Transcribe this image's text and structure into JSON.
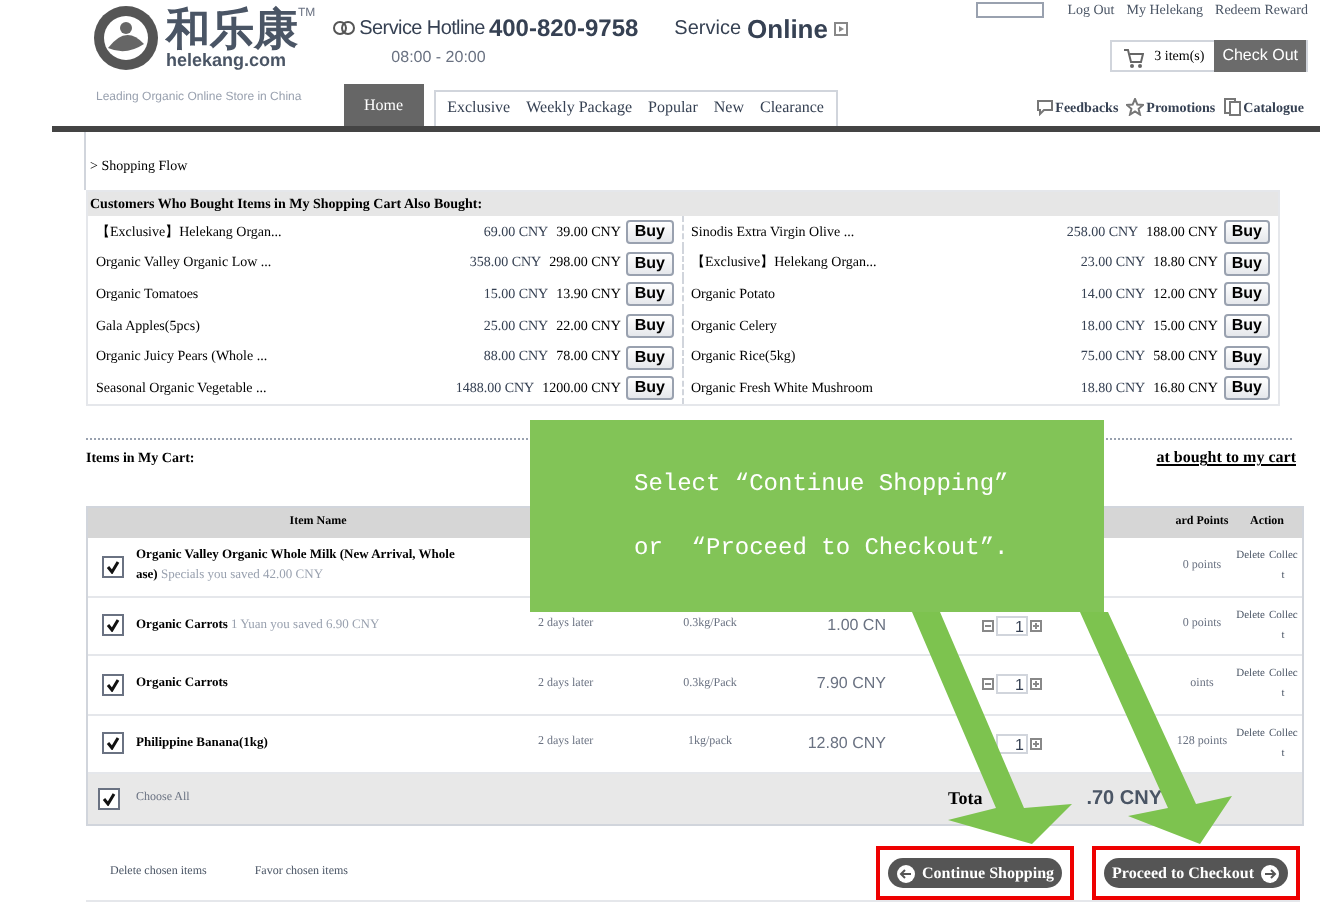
{
  "header": {
    "logo_cn": "和乐康",
    "logo_tm": "TM",
    "logo_domain": "helekang.com",
    "tagline": "Leading Organic Online Store in China",
    "hotline_label": "Service Hotline",
    "hotline_number": "400-820-9758",
    "hours": "08:00 - 20:00",
    "service_label": "Service",
    "service_online": "Online",
    "top_links": [
      "Log Out",
      "My Helekang",
      "Redeem Reward"
    ],
    "cart_count": "3 item(s)",
    "checkout": "Check Out"
  },
  "nav": {
    "tabs": [
      {
        "label": "Home",
        "selected": true
      },
      {
        "label": "Exclusive",
        "selected": false
      },
      {
        "label": "Weekly Package",
        "selected": false
      },
      {
        "label": "Popular",
        "selected": false
      },
      {
        "label": "New",
        "selected": false
      },
      {
        "label": "Clearance",
        "selected": false
      }
    ],
    "links": [
      "Feedbacks",
      "Promotions",
      "Catalogue"
    ]
  },
  "breadcrumb": "> Shopping Flow",
  "recommend": {
    "title": "Customers Who Bought Items in My Shopping Cart Also Bought:",
    "items": [
      {
        "name": "【Exclusive】Helekang Organ...",
        "old": "69.00 CNY",
        "price": "39.00 CNY",
        "buy": "Buy"
      },
      {
        "name": "Sinodis Extra Virgin Olive ...",
        "old": "258.00 CNY",
        "price": "188.00 CNY",
        "buy": "Buy"
      },
      {
        "name": "Organic Valley Organic Low ...",
        "old": "358.00 CNY",
        "price": "298.00 CNY",
        "buy": "Buy"
      },
      {
        "name": "【Exclusive】Helekang Organ...",
        "old": "23.00 CNY",
        "price": "18.80 CNY",
        "buy": "Buy"
      },
      {
        "name": "Organic Tomatoes",
        "old": "15.00 CNY",
        "price": "13.90 CNY",
        "buy": "Buy"
      },
      {
        "name": "Organic Potato",
        "old": "14.00 CNY",
        "price": "12.00 CNY",
        "buy": "Buy"
      },
      {
        "name": "Gala Apples(5pcs)",
        "old": "25.00 CNY",
        "price": "22.00 CNY",
        "buy": "Buy"
      },
      {
        "name": "Organic Celery",
        "old": "18.00 CNY",
        "price": "15.00 CNY",
        "buy": "Buy"
      },
      {
        "name": "Organic Juicy Pears (Whole ...",
        "old": "88.00 CNY",
        "price": "78.00 CNY",
        "buy": "Buy"
      },
      {
        "name": "Organic Rice(5kg)",
        "old": "75.00 CNY",
        "price": "58.00 CNY",
        "buy": "Buy"
      },
      {
        "name": "Seasonal Organic Vegetable ...",
        "old": "1488.00 CNY",
        "price": "1200.00 CNY",
        "buy": "Buy"
      },
      {
        "name": "Organic Fresh White Mushroom",
        "old": "18.80 CNY",
        "price": "16.80 CNY",
        "buy": "Buy"
      }
    ]
  },
  "cart": {
    "title": "Items in My Cart:",
    "link": "at bought to my cart",
    "columns": [
      "Item Name",
      "ard Points",
      "Action"
    ],
    "rows": [
      {
        "checked": true,
        "name": "Organic Valley Organic Whole Milk (New Arrival, Whole",
        "name_2": "ase)",
        "note": "Specials you saved 42.00 CNY",
        "points": "0 points",
        "actions": [
          "Delete",
          "Collec",
          "t"
        ]
      },
      {
        "checked": true,
        "name": "Organic Carrots",
        "note": "1 Yuan you saved 6.90 CNY",
        "delivery": "2 days later",
        "spec": "0.3kg/Pack",
        "price": "1.00 CN",
        "qty": "1",
        "minus": true,
        "points": "0 points",
        "actions": [
          "Delete",
          "Collec",
          "t"
        ]
      },
      {
        "checked": true,
        "name": "Organic Carrots",
        "delivery": "2 days later",
        "spec": "0.3kg/Pack",
        "price": "7.90 CNY",
        "qty": "1",
        "minus": true,
        "points": "oints",
        "actions": [
          "Delete",
          "Collec",
          "t"
        ]
      },
      {
        "checked": true,
        "name": "Philippine Banana(1kg)",
        "delivery": "2 days later",
        "spec": "1kg/pack",
        "price": "12.80 CNY",
        "qty": "1",
        "minus": false,
        "points": "128 points",
        "actions": [
          "Delete",
          "Collec",
          "t"
        ]
      }
    ],
    "choose_all": {
      "label": "Choose All",
      "checked": true
    },
    "total_label": "Tota",
    "total": ".70 CNY",
    "delete_chosen": "Delete chosen items",
    "favor_chosen": "Favor chosen items",
    "continue": "Continue Shopping",
    "proceed": "Proceed to Checkout"
  },
  "callout": {
    "lines": [
      "Select “Continue Shopping”",
      "or  “Proceed to Checkout”."
    ]
  }
}
